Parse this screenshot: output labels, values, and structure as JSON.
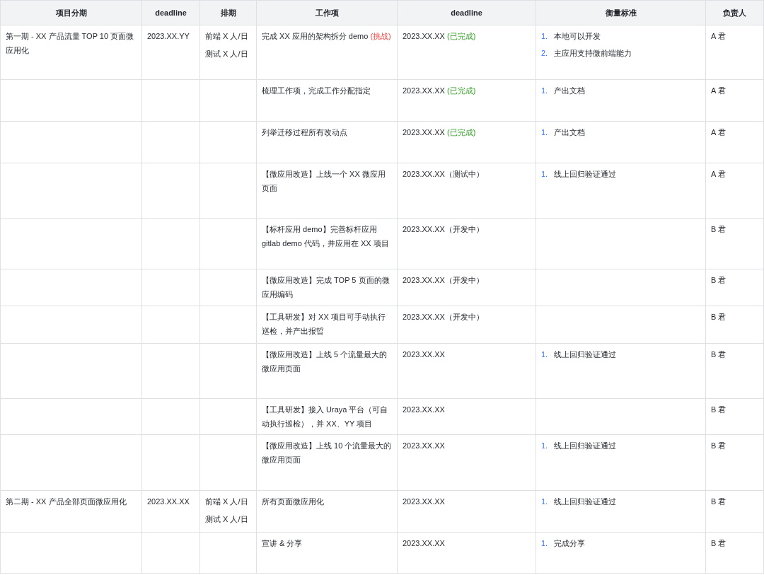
{
  "table": {
    "columns": [
      "项目分期",
      "deadline",
      "排期",
      "工作项",
      "deadline",
      "衡量标准",
      "负责人"
    ],
    "rows": [
      {
        "phase": "第一期 - XX 产品流量 TOP 10 页面微应用化",
        "phase_deadline": "2023.XX.YY",
        "schedule": [
          "前端 X 人/日",
          "测试 X 人/日"
        ],
        "work_item": {
          "text": "完成 XX 应用的架构拆分 demo",
          "tag": {
            "text": "(挑战)",
            "kind": "challenge"
          }
        },
        "deadline": {
          "date": "2023.XX.XX",
          "status": {
            "text": "(已完成)",
            "kind": "done"
          }
        },
        "criteria": [
          {
            "number": "1.",
            "text": "本地可以开发"
          },
          {
            "number": "2.",
            "text": "主应用支持微前端能力"
          }
        ],
        "owner": "A 君"
      },
      {
        "work_item": {
          "text": "梳理工作项，完成工作分配指定"
        },
        "deadline": {
          "date": "2023.XX.XX",
          "status": {
            "text": "(已完成)",
            "kind": "done"
          }
        },
        "criteria": [
          {
            "number": "1.",
            "text": "产出文档"
          }
        ],
        "owner": "A 君"
      },
      {
        "work_item": {
          "text": "列举迁移过程所有改动点"
        },
        "deadline": {
          "date": "2023.XX.XX",
          "status": {
            "text": "(已完成)",
            "kind": "done"
          }
        },
        "criteria": [
          {
            "number": "1.",
            "text": "产出文档"
          }
        ],
        "owner": "A 君"
      },
      {
        "work_item": {
          "text": "【微应用改造】上线一个 XX 微应用页面"
        },
        "deadline": {
          "date": "2023.XX.XX",
          "status": {
            "text": "（测试中）",
            "kind": "plain"
          }
        },
        "criteria": [
          {
            "number": "1.",
            "text": "线上回归验证通过"
          }
        ],
        "owner": "A 君"
      },
      {
        "work_item": {
          "text": "【标杆应用 demo】完善标杆应用 gitlab demo 代码，并应用在 XX 项目"
        },
        "deadline": {
          "date": "2023.XX.XX",
          "status": {
            "text": "（开发中）",
            "kind": "plain"
          }
        },
        "owner": "B 君"
      },
      {
        "work_item": {
          "text": "【微应用改造】完成 TOP 5 页面的微应用编码"
        },
        "deadline": {
          "date": "2023.XX.XX",
          "status": {
            "text": "（开发中）",
            "kind": "plain"
          }
        },
        "owner": "B 君"
      },
      {
        "work_item": {
          "text": "【工具研发】对 XX 项目可手动执行巡检，并产出报晢"
        },
        "deadline": {
          "date": "2023.XX.XX",
          "status": {
            "text": "（开发中）",
            "kind": "plain"
          }
        },
        "owner": "B 君"
      },
      {
        "work_item": {
          "text": "【微应用改造】上线 5 个流量最大的微应用页面"
        },
        "deadline": {
          "date": "2023.XX.XX"
        },
        "criteria": [
          {
            "number": "1.",
            "text": "线上回归验证通过"
          }
        ],
        "owner": "B 君"
      },
      {
        "work_item": {
          "text": "【工具研发】接入 Uraya 平台（可自动执行巡检），并 XX、YY 项目"
        },
        "deadline": {
          "date": "2023.XX.XX"
        },
        "owner": "B 君"
      },
      {
        "work_item": {
          "text": "【微应用改造】上线 10 个流量最大的微应用页面"
        },
        "deadline": {
          "date": "2023.XX.XX"
        },
        "criteria": [
          {
            "number": "1.",
            "text": "线上回归验证通过"
          }
        ],
        "owner": "B 君"
      },
      {
        "phase": "第二期 - XX 产品全部页面微应用化",
        "phase_deadline": "2023.XX.XX",
        "schedule": [
          "前端 X 人/日",
          "测试 X 人/日"
        ],
        "work_item": {
          "text": "所有页面微应用化"
        },
        "deadline": {
          "date": "2023.XX.XX"
        },
        "criteria": [
          {
            "number": "1.",
            "text": "线上回归验证通过"
          }
        ],
        "owner": "B 君"
      },
      {
        "work_item": {
          "text": "宣讲 & 分享"
        },
        "deadline": {
          "date": "2023.XX.XX"
        },
        "criteria": [
          {
            "number": "1.",
            "text": "完成分享"
          }
        ],
        "owner": "B 君"
      }
    ]
  }
}
